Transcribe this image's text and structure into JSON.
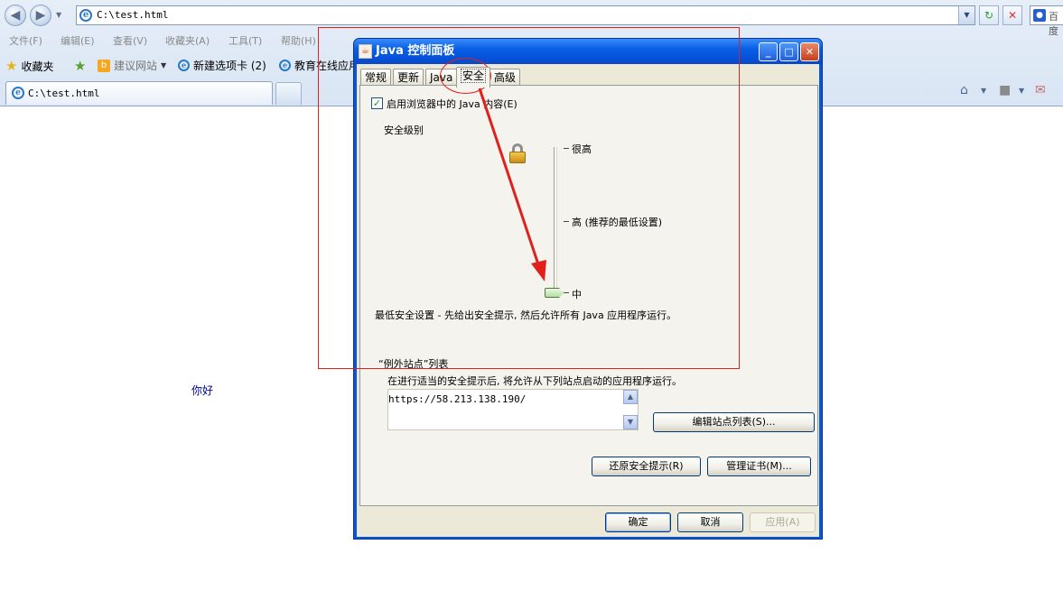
{
  "browser": {
    "address_url": "C:\\test.html",
    "search_hint": "百度",
    "menus": [
      "文件(F)",
      "编辑(E)",
      "查看(V)",
      "收藏夹(A)",
      "工具(T)",
      "帮助(H)"
    ],
    "favorites": {
      "label": "收藏夹",
      "suggested_sites": "建议网站",
      "new_tab_item": "新建选项卡 (2)",
      "education_item": "教育在线应用"
    },
    "tab_label": "C:\\test.html"
  },
  "page": {
    "body_text": "你好"
  },
  "dialog": {
    "title": "Java 控制面板",
    "tabs": [
      "常规",
      "更新",
      "Java",
      "安全",
      "高级"
    ],
    "active_tab": "安全",
    "enable_java_label": "启用浏览器中的 Java 内容(E)",
    "enable_java_checked": true,
    "security_level_label": "安全级别",
    "levels": {
      "very_high": "很高",
      "high": "高 (推荐的最低设置)",
      "medium": "中"
    },
    "selected_level": "中",
    "level_description": "最低安全设置 - 先给出安全提示, 然后允许所有 Java 应用程序运行。",
    "exception_title": "“例外站点”列表",
    "exception_desc": "在进行适当的安全提示后, 将允许从下列站点启动的应用程序运行。",
    "exception_sites": [
      "https://58.213.138.190/"
    ],
    "edit_site_list_button": "编辑站点列表(S)...",
    "restore_prompts_button": "还原安全提示(R)",
    "manage_certs_button": "管理证书(M)...",
    "ok_button": "确定",
    "cancel_button": "取消",
    "apply_button": "应用(A)"
  },
  "colors": {
    "annotation": "#e0211b",
    "title_bar": "#0a56d8",
    "dialog_bg": "#ece9d8"
  }
}
